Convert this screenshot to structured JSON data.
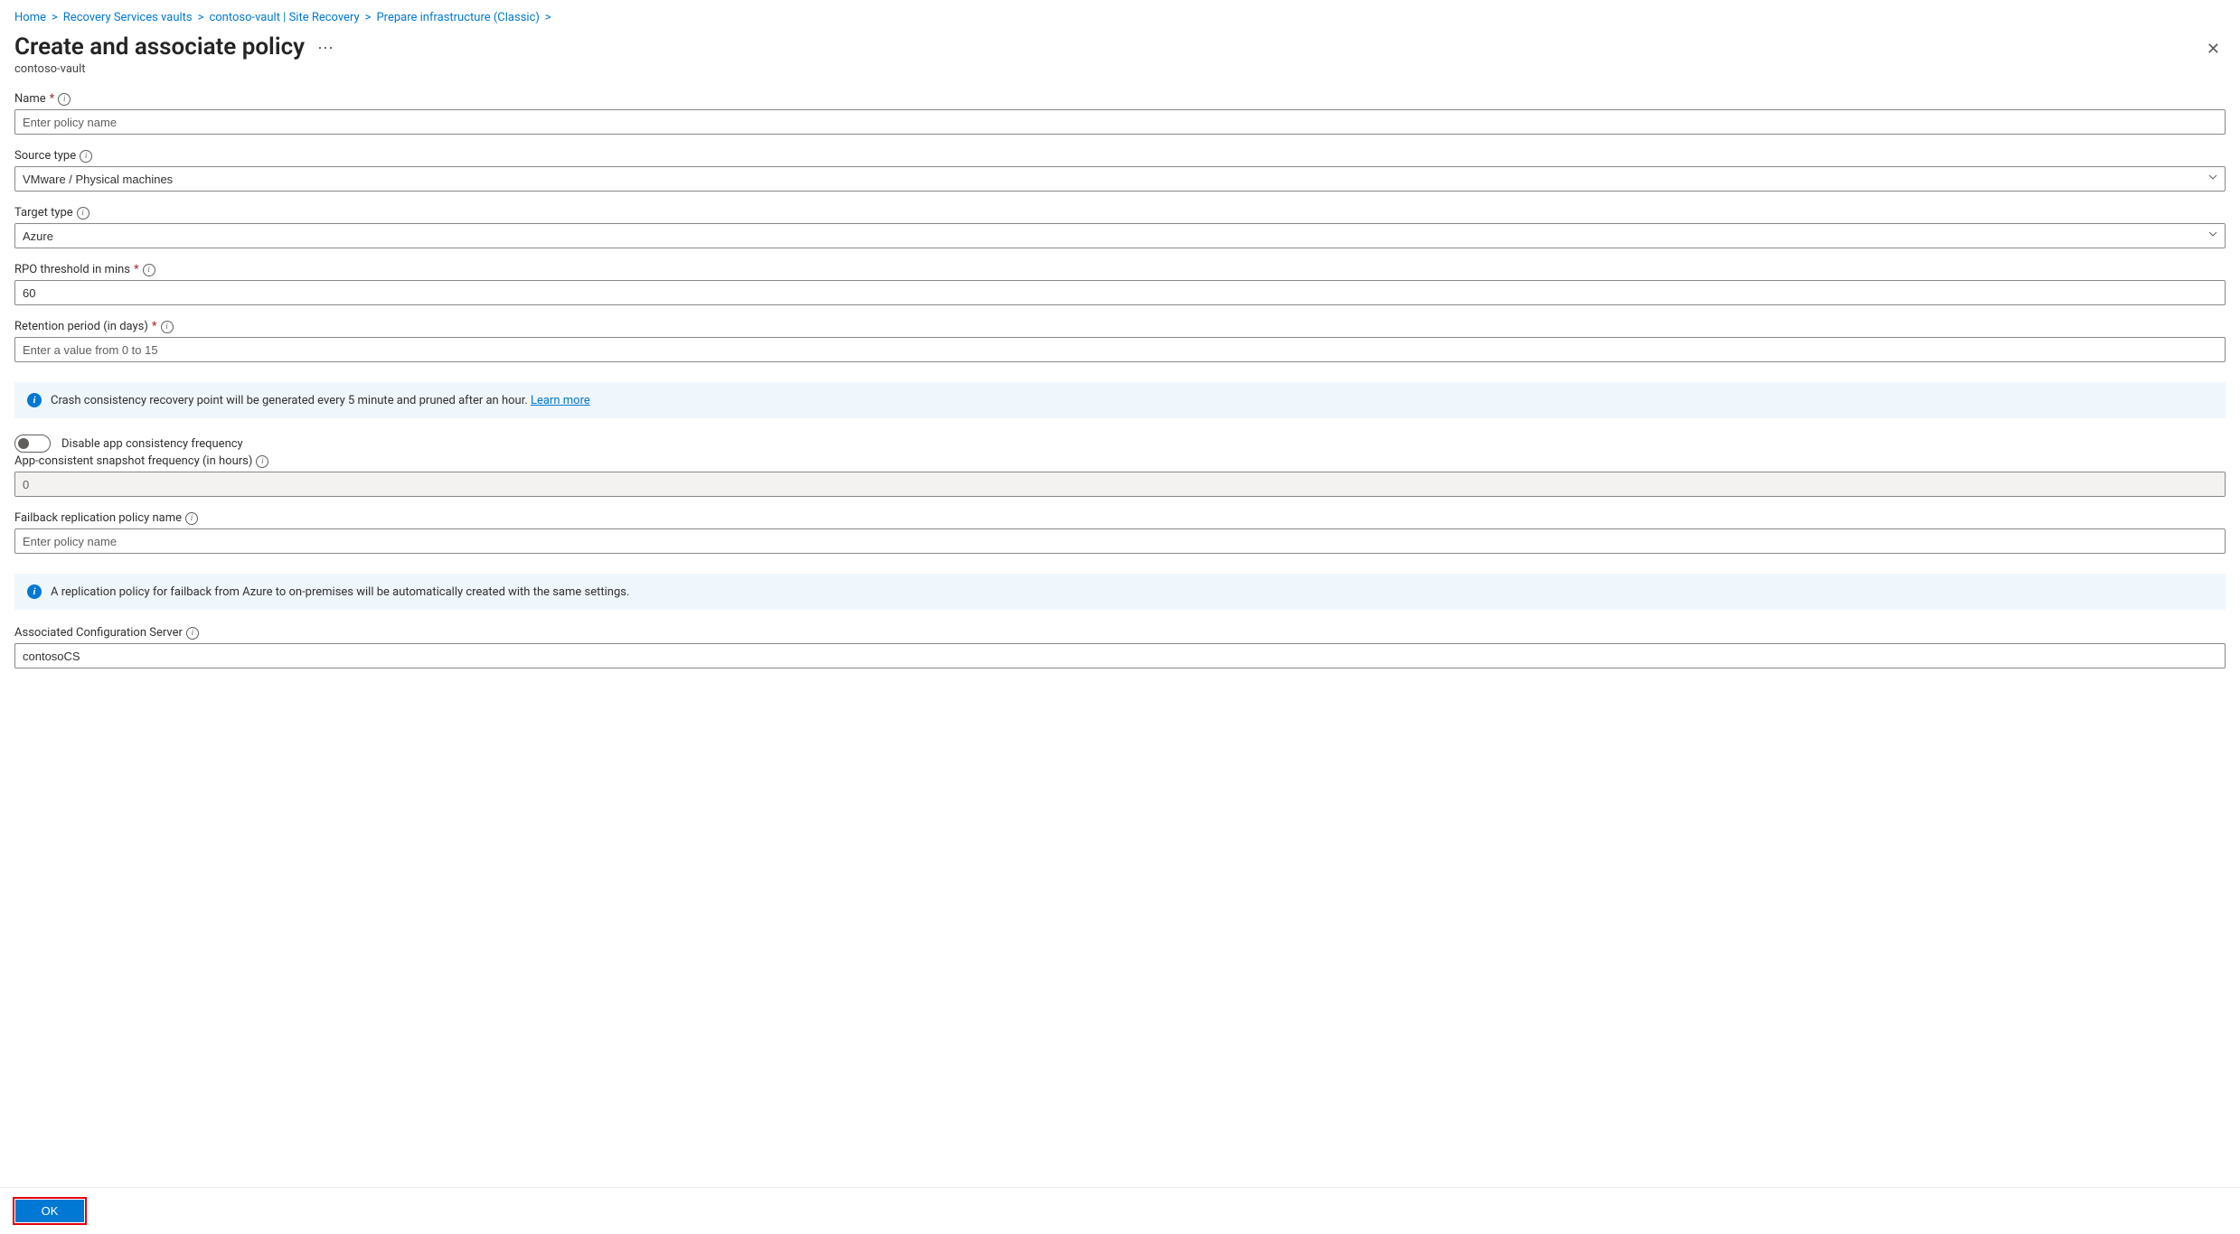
{
  "breadcrumb": {
    "items": [
      {
        "label": "Home"
      },
      {
        "label": "Recovery Services vaults"
      },
      {
        "label": "contoso-vault | Site Recovery"
      },
      {
        "label": "Prepare infrastructure (Classic)"
      }
    ]
  },
  "header": {
    "title": "Create and associate policy",
    "subtitle": "contoso-vault"
  },
  "fields": {
    "name": {
      "label": "Name",
      "placeholder": "Enter policy name",
      "value": ""
    },
    "source_type": {
      "label": "Source type",
      "value": "VMware / Physical machines"
    },
    "target_type": {
      "label": "Target type",
      "value": "Azure"
    },
    "rpo": {
      "label": "RPO threshold in mins",
      "value": "60"
    },
    "retention": {
      "label": "Retention period (in days)",
      "placeholder": "Enter a value from 0 to 15",
      "value": ""
    },
    "disable_app_consistency": {
      "label": "Disable app consistency frequency"
    },
    "app_snapshot": {
      "label": "App-consistent snapshot frequency (in hours)",
      "value": "0"
    },
    "failback_policy": {
      "label": "Failback replication policy name",
      "placeholder": "Enter policy name",
      "value": ""
    },
    "assoc_server": {
      "label": "Associated Configuration Server",
      "value": "contosoCS"
    }
  },
  "messages": {
    "crash_consistency": {
      "text": "Crash consistency recovery point will be generated every 5 minute and pruned after an hour. ",
      "link": "Learn more"
    },
    "failback_info": "A replication policy for failback from Azure to on-premises will be automatically created with the same settings."
  },
  "footer": {
    "ok": "OK"
  }
}
